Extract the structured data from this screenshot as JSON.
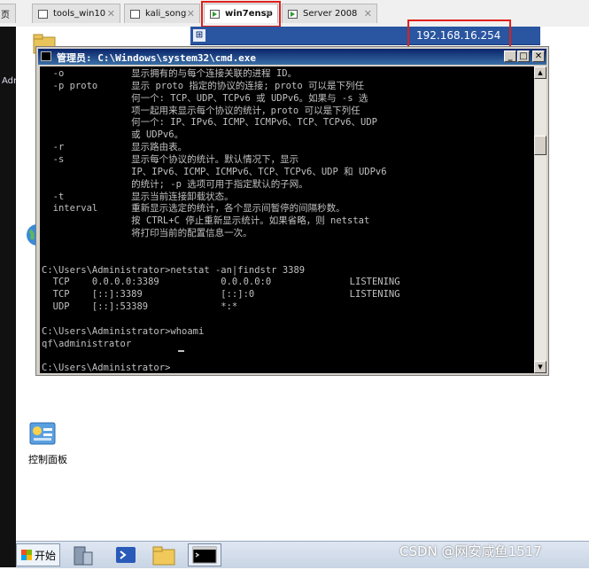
{
  "tabs": [
    {
      "label": "页",
      "icon": "blank-icon"
    },
    {
      "label": "tools_win10",
      "icon": "vm-icon"
    },
    {
      "label": "kali_song",
      "icon": "vm-icon"
    },
    {
      "label": "win7ensp",
      "icon": "vm-running-icon"
    },
    {
      "label": "Server 2008",
      "icon": "vm-running-icon"
    }
  ],
  "desktop_left_label": "Adm",
  "vm_bar": {
    "pin_glyph": "⊞",
    "ip": "192.168.16.254"
  },
  "cmd": {
    "title": "管理员: C:\\Windows\\system32\\cmd.exe",
    "lines": [
      "  -o            显示拥有的与每个连接关联的进程 ID。",
      "  -p proto      显示 proto 指定的协议的连接; proto 可以是下列任",
      "                何一个: TCP、UDP、TCPv6 或 UDPv6。如果与 -s 选",
      "                项一起用来显示每个协议的统计，proto 可以是下列任",
      "                何一个: IP、IPv6、ICMP、ICMPv6、TCP、TCPv6、UDP",
      "                或 UDPv6。",
      "  -r            显示路由表。",
      "  -s            显示每个协议的统计。默认情况下，显示",
      "                IP、IPv6、ICMP、ICMPv6、TCP、TCPv6、UDP 和 UDPv6",
      "                的统计; -p 选项可用于指定默认的子网。",
      "  -t            显示当前连接卸载状态。",
      "  interval      重新显示选定的统计，各个显示间暂停的间隔秒数。",
      "                按 CTRL+C 停止重新显示统计。如果省略，则 netstat",
      "                将打印当前的配置信息一次。",
      "",
      "",
      "C:\\Users\\Administrator>netstat -an|findstr 3389",
      "  TCP    0.0.0.0:3389           0.0.0.0:0              LISTENING",
      "  TCP    [::]:3389              [::]:0                 LISTENING",
      "  UDP    [::]:53389             *:*",
      "",
      "C:\\Users\\Administrator>whoami",
      "qf\\administrator",
      "",
      "C:\\Users\\Administrator>"
    ]
  },
  "desktop_icons": [
    {
      "label": "控制面板",
      "icon": "control-panel-icon"
    }
  ],
  "taskbar": {
    "start_label": "开始",
    "apps": [
      "server-manager-icon",
      "powershell-icon",
      "explorer-folder-icon",
      "cmd-icon"
    ]
  },
  "watermark": "CSDN @网安咸鱼1517",
  "colors": {
    "highlight_box": "#e0201b",
    "console_bg": "#000000",
    "console_text": "#c0c0c0",
    "title_bar": "#0a246a"
  }
}
